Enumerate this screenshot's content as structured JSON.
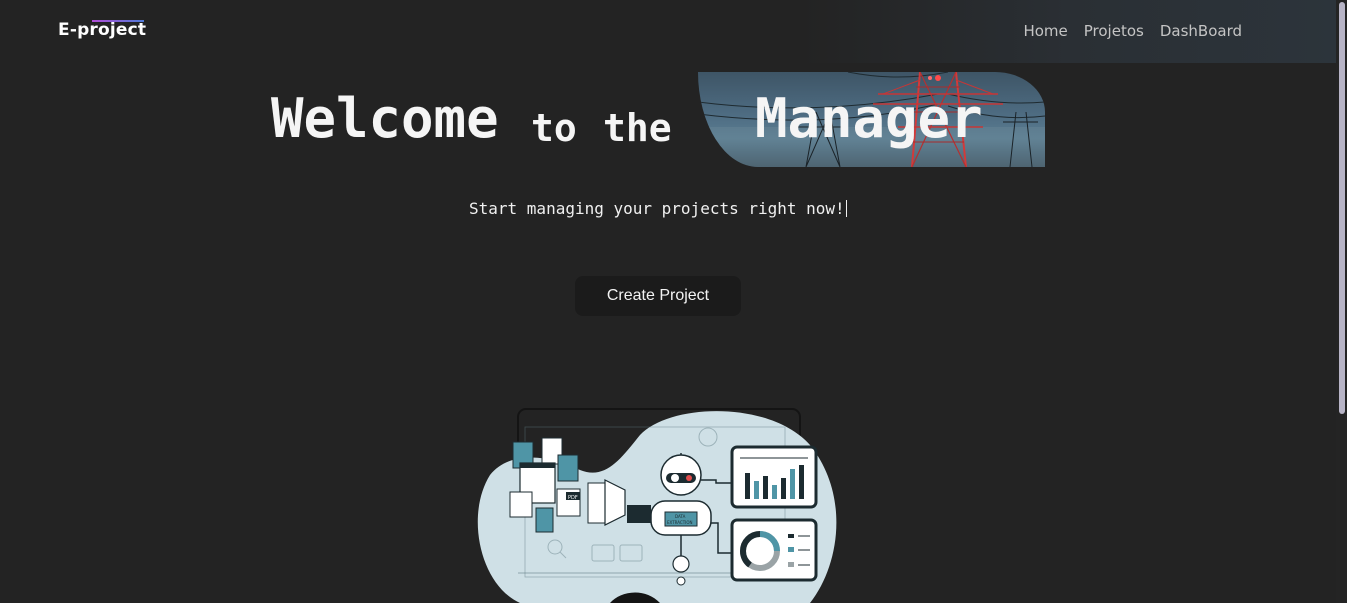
{
  "navbar": {
    "logo": "E-project",
    "links": [
      "Home",
      "Projetos",
      "DashBoard"
    ]
  },
  "hero": {
    "title_parts": [
      "Welcome",
      "to",
      "the",
      "Manager"
    ],
    "subtitle": "Start managing your projects right now!",
    "cta_label": "Create Project"
  },
  "illustration": {
    "robot_label_line1": "DATA",
    "robot_label_line2": "EXTRACTION",
    "pdf_label": "PDF"
  },
  "colors": {
    "background": "#232323",
    "button": "#1b1b1b",
    "illustration_blob": "#cfe0e6",
    "accent_teal": "#4f95a6"
  }
}
